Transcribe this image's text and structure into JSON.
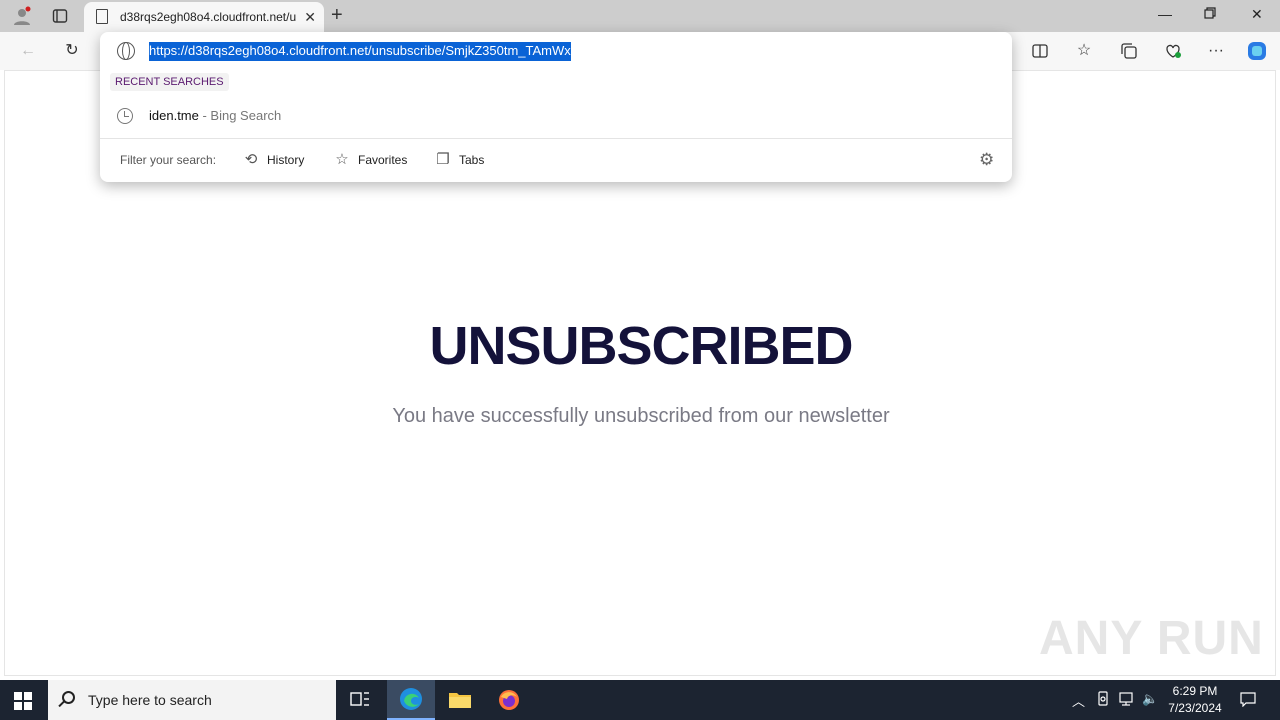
{
  "browser": {
    "tab_title": "d38rqs2egh08o4.cloudfront.net/u",
    "address_url": "https://d38rqs2egh08o4.cloudfront.net/unsubscribe/SmjkZ350tm_TAmWx"
  },
  "omnibox": {
    "recent_label": "RECENT SEARCHES",
    "suggestion": {
      "query": "iden.tme",
      "source": " - Bing Search"
    },
    "filter_label": "Filter your search:",
    "filters": [
      "History",
      "Favorites",
      "Tabs"
    ]
  },
  "page": {
    "headline": "UNSUBSCRIBED",
    "message": "You have successfully unsubscribed from our newsletter",
    "watermark": "ANY RUN"
  },
  "taskbar": {
    "search_placeholder": "Type here to search",
    "time": "6:29 PM",
    "date": "7/23/2024"
  },
  "colors": {
    "url_highlight": "#0a63d6",
    "headline": "#14123a",
    "taskbar_bg": "#1c2431"
  }
}
